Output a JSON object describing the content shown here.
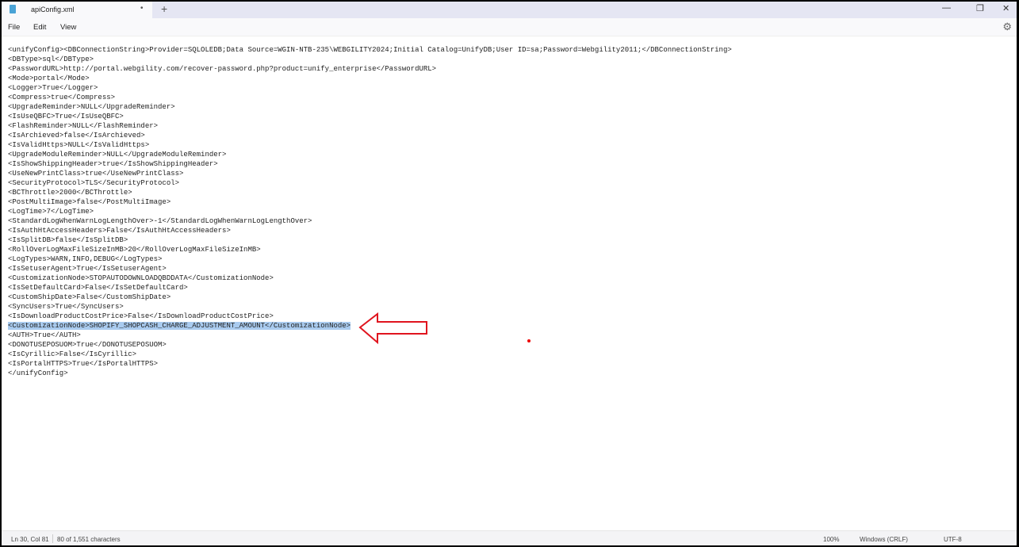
{
  "tab": {
    "title": "apiConfig.xml",
    "unsaved_marker": "•",
    "new_tab": "+"
  },
  "window_controls": {
    "minimize": "—",
    "maximize": "❐",
    "close": "✕"
  },
  "menu": [
    "File",
    "Edit",
    "View"
  ],
  "settings_icon": "⚙",
  "editor": {
    "lines": [
      "<unifyConfig><DBConnectionString>Provider=SQLOLEDB;Data Source=WGIN-NTB-235\\WEBGILITY2024;Initial Catalog=UnifyDB;User ID=sa;Password=Webgility2011;</DBConnectionString>",
      "<DBType>sql</DBType>",
      "<PasswordURL>http://portal.webgility.com/recover-password.php?product=unify_enterprise</PasswordURL>",
      "<Mode>portal</Mode>",
      "<Logger>True</Logger>",
      "<Compress>true</Compress>",
      "<UpgradeReminder>NULL</UpgradeReminder>",
      "<IsUseQBFC>True</IsUseQBFC>",
      "<FlashReminder>NULL</FlashReminder>",
      "<IsArchieved>false</IsArchieved>",
      "<IsValidHttps>NULL</IsValidHttps>",
      "<UpgradeModuleReminder>NULL</UpgradeModuleReminder>",
      "<IsShowShippingHeader>true</IsShowShippingHeader>",
      "<UseNewPrintClass>true</UseNewPrintClass>",
      "<SecurityProtocol>TLS</SecurityProtocol>",
      "<BCThrottle>2000</BCThrottle>",
      "<PostMultiImage>false</PostMultiImage>",
      "<LogTime>7</LogTime>",
      "<StandardLogWhenWarnLogLengthOver>-1</StandardLogWhenWarnLogLengthOver>",
      "<IsAuthHtAccessHeaders>False</IsAuthHtAccessHeaders>",
      "<IsSplitDB>false</IsSplitDB>",
      "<RollOverLogMaxFileSizeInMB>20</RollOverLogMaxFileSizeInMB>",
      "<LogTypes>WARN,INFO,DEBUG</LogTypes>",
      "<IsSetuserAgent>True</IsSetuserAgent>",
      "<CustomizationNode>STOPAUTODOWNLOADQBDDATA</CustomizationNode>",
      "<IsSetDefaultCard>False</IsSetDefaultCard>",
      "<CustomShipDate>False</CustomShipDate>",
      "<SyncUsers>True</SyncUsers>",
      "<IsDownloadProductCostPrice>False</IsDownloadProductCostPrice>",
      "<CustomizationNode>SHOPIFY_SHOPCASH_CHARGE_ADJUSTMENT_AMOUNT</CustomizationNode>",
      "<AUTH>True</AUTH>",
      "<DONOTUSEPOSUOM>True</DONOTUSEPOSUOM>",
      "<IsCyrillic>False</IsCyrillic>",
      "<IsPortalHTTPS>True</IsPortalHTTPS>",
      "</unifyConfig>"
    ],
    "selected_line": 30
  },
  "status": {
    "position": "Ln 30, Col 81",
    "chars": "80 of 1,551 characters",
    "zoom": "100%",
    "line_ending": "Windows (CRLF)",
    "encoding": "UTF-8"
  },
  "colors": {
    "selection": "#a9cbef",
    "annotation": "#e0141e"
  }
}
